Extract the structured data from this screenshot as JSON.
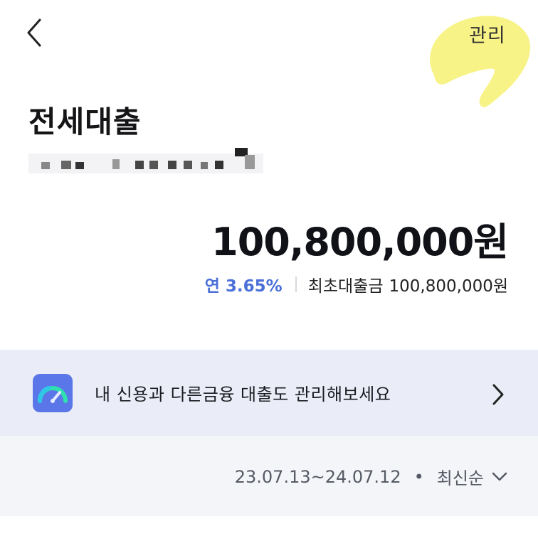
{
  "header": {
    "manage_label": "관리"
  },
  "loan": {
    "title": "전세대출",
    "amount": "100,800,000원",
    "rate": "연 3.65%",
    "initial_label": "최초대출금",
    "initial_amount": "100,800,000원"
  },
  "promo": {
    "text": "내 신용과 다른금융 대출도 관리해보세요"
  },
  "filter": {
    "date_range": "23.07.13~24.07.12",
    "separator": "•",
    "sort_label": "최신순"
  },
  "icons": {
    "back": "chevron-left-icon",
    "promo": "gauge-icon",
    "promo_arrow": "chevron-right-icon",
    "sort": "chevron-down-icon"
  },
  "colors": {
    "rate_accent": "#4a6fd7",
    "promo_bg": "#eaedf7",
    "filter_bg": "#f4f5f9",
    "highlight": "#f7f27a"
  }
}
